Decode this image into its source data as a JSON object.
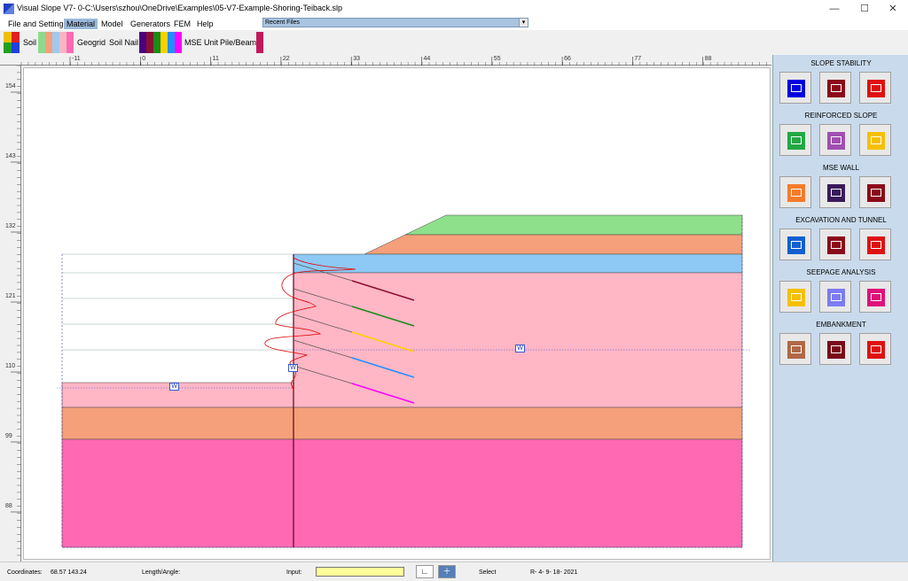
{
  "window": {
    "title": "Visual Slope V7- 0-C:\\Users\\szhou\\OneDrive\\Examples\\05-V7-Example-Shoring-Teiback.slp",
    "minimize": "—",
    "maximize": "☐",
    "close": "✕"
  },
  "menu": [
    "File and Setting",
    "Material",
    "Model",
    "Generators",
    "FEM",
    "Help"
  ],
  "active_menu": "Material",
  "recent_files": "Recent Files",
  "toolbar": {
    "soil_label": "Soil",
    "geogrid_label": "Geogrid",
    "soilnail_label": "Soil Nail",
    "mse_label": "MSE Unit",
    "pile_label": "Pile/Beam",
    "soil_swatches": [
      "#8fd98f",
      "#f5a07a",
      "#9ec9f0",
      "#f7b5c3",
      "#ff69b4"
    ],
    "nail_swatches": [
      "#4b0082",
      "#8b1030",
      "#1a8c1a",
      "#ffd000",
      "#1e90ff",
      "#ff00ff"
    ],
    "pile_swatch": "#c2185b"
  },
  "hruler_ticks": [
    "-11",
    "0",
    "11",
    "22",
    "33",
    "44",
    "55",
    "66",
    "77",
    "88"
  ],
  "vruler_ticks": [
    "154",
    "143",
    "132",
    "121",
    "110",
    "99",
    "88"
  ],
  "canvas": {
    "water_label": "W",
    "colors": {
      "green": "#8fe08a",
      "orange": "#f5a07a",
      "blue": "#8ec9f5",
      "pink": "#ffb6c5",
      "salmon": "#f5a07a",
      "magenta": "#ff69b4"
    },
    "anchor_colors": [
      "#8b1030",
      "#1a8c1a",
      "#ffd000",
      "#1e90ff",
      "#ff00ff"
    ]
  },
  "panel": {
    "sections": [
      {
        "title": "SLOPE STABILITY",
        "icons": [
          {
            "name": "slope-stability-1-icon",
            "color": "#0000e0"
          },
          {
            "name": "slope-stability-2-icon",
            "color": "#8b0a1a"
          },
          {
            "name": "slope-stability-3-icon",
            "color": "#e01010"
          }
        ]
      },
      {
        "title": "REINFORCED SLOPE",
        "icons": [
          {
            "name": "reinforced-slope-1-icon",
            "color": "#22a845"
          },
          {
            "name": "reinforced-slope-2-icon",
            "color": "#a050b0"
          },
          {
            "name": "reinforced-slope-3-icon",
            "color": "#f5c000"
          }
        ]
      },
      {
        "title": "MSE WALL",
        "icons": [
          {
            "name": "mse-wall-1-icon",
            "color": "#f57b2a"
          },
          {
            "name": "mse-wall-2-icon",
            "color": "#3a1a5a"
          },
          {
            "name": "mse-wall-3-icon",
            "color": "#8b0a1a"
          }
        ]
      },
      {
        "title": "EXCAVATION AND TUNNEL",
        "icons": [
          {
            "name": "excavation-1-icon",
            "color": "#1060d0"
          },
          {
            "name": "excavation-2-icon",
            "color": "#8b0a1a"
          },
          {
            "name": "tunnel-icon",
            "color": "#e01010"
          }
        ]
      },
      {
        "title": "SEEPAGE ANALYSIS",
        "icons": [
          {
            "name": "seepage-1-icon",
            "color": "#f5c000"
          },
          {
            "name": "seepage-2-icon",
            "color": "#7c7cf0"
          },
          {
            "name": "seepage-3-icon",
            "color": "#e0107a"
          }
        ]
      },
      {
        "title": "EMBANKMENT",
        "icons": [
          {
            "name": "embankment-1-icon",
            "color": "#b06848"
          },
          {
            "name": "embankment-2-icon",
            "color": "#7a0a1a"
          },
          {
            "name": "embankment-3-icon",
            "color": "#e01010"
          }
        ]
      }
    ]
  },
  "status": {
    "coords_label": "Coordinates:",
    "coords_value": "68.57  143.24",
    "length_label": "Length/Angle:",
    "input_label": "Input:",
    "select_label": "Select",
    "version": "R- 4- 9- 18- 2021"
  }
}
